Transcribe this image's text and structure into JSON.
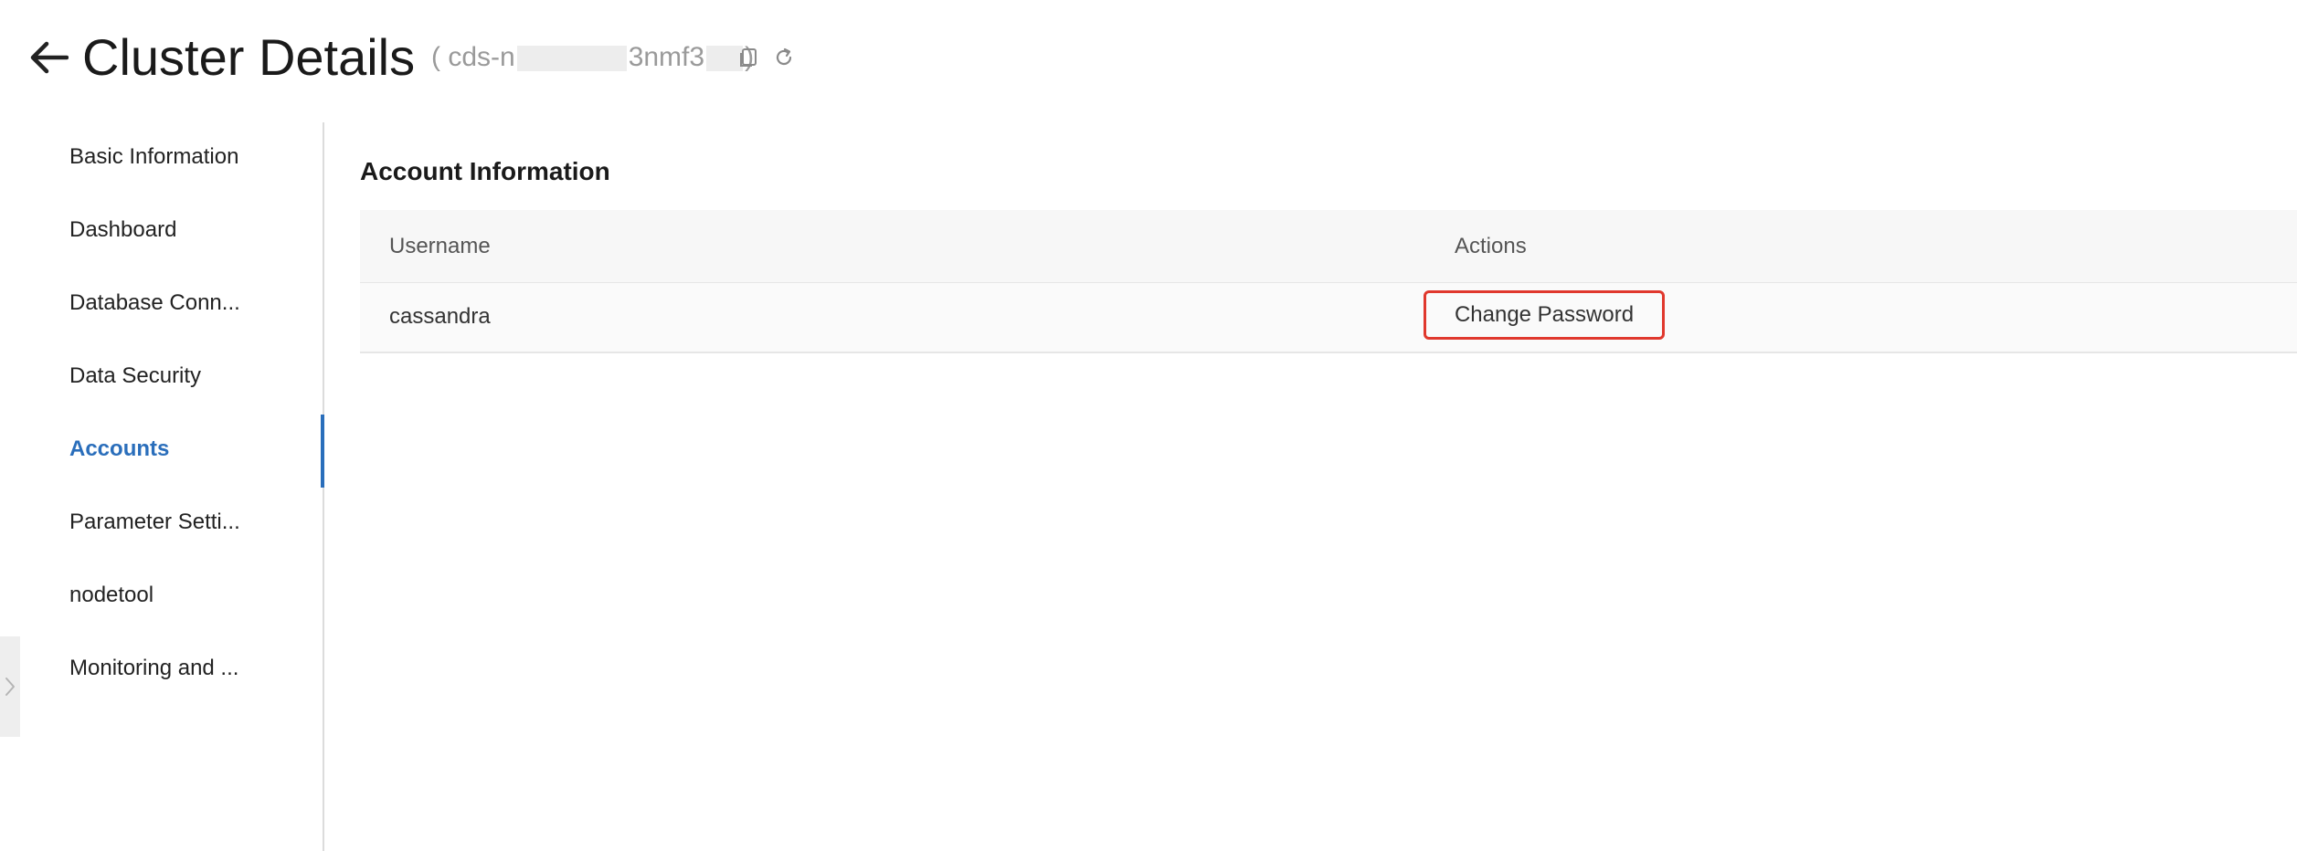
{
  "header": {
    "title": "Cluster Details",
    "cluster_id_prefix": "( cds-n",
    "cluster_id_middle": "3nmf3",
    "cluster_id_suffix": ")",
    "back_icon": "arrow-left-icon",
    "copy_icon": "copy-icon",
    "refresh_icon": "refresh-icon"
  },
  "sidebar": {
    "active_color": "#2a6ebb",
    "items": [
      {
        "label": "Basic Information"
      },
      {
        "label": "Dashboard"
      },
      {
        "label": "Database Conn..."
      },
      {
        "label": "Data Security"
      },
      {
        "label": "Accounts",
        "active": true
      },
      {
        "label": "Parameter Setti..."
      },
      {
        "label": "nodetool"
      },
      {
        "label": "Monitoring and ..."
      }
    ],
    "collapse_icon": "chevron-right-icon"
  },
  "main": {
    "section_title": "Account Information",
    "table": {
      "columns": [
        "Username",
        "Actions"
      ],
      "rows": [
        {
          "username": "cassandra",
          "action": "Change Password"
        }
      ]
    },
    "highlight_color": "#e0382d"
  }
}
